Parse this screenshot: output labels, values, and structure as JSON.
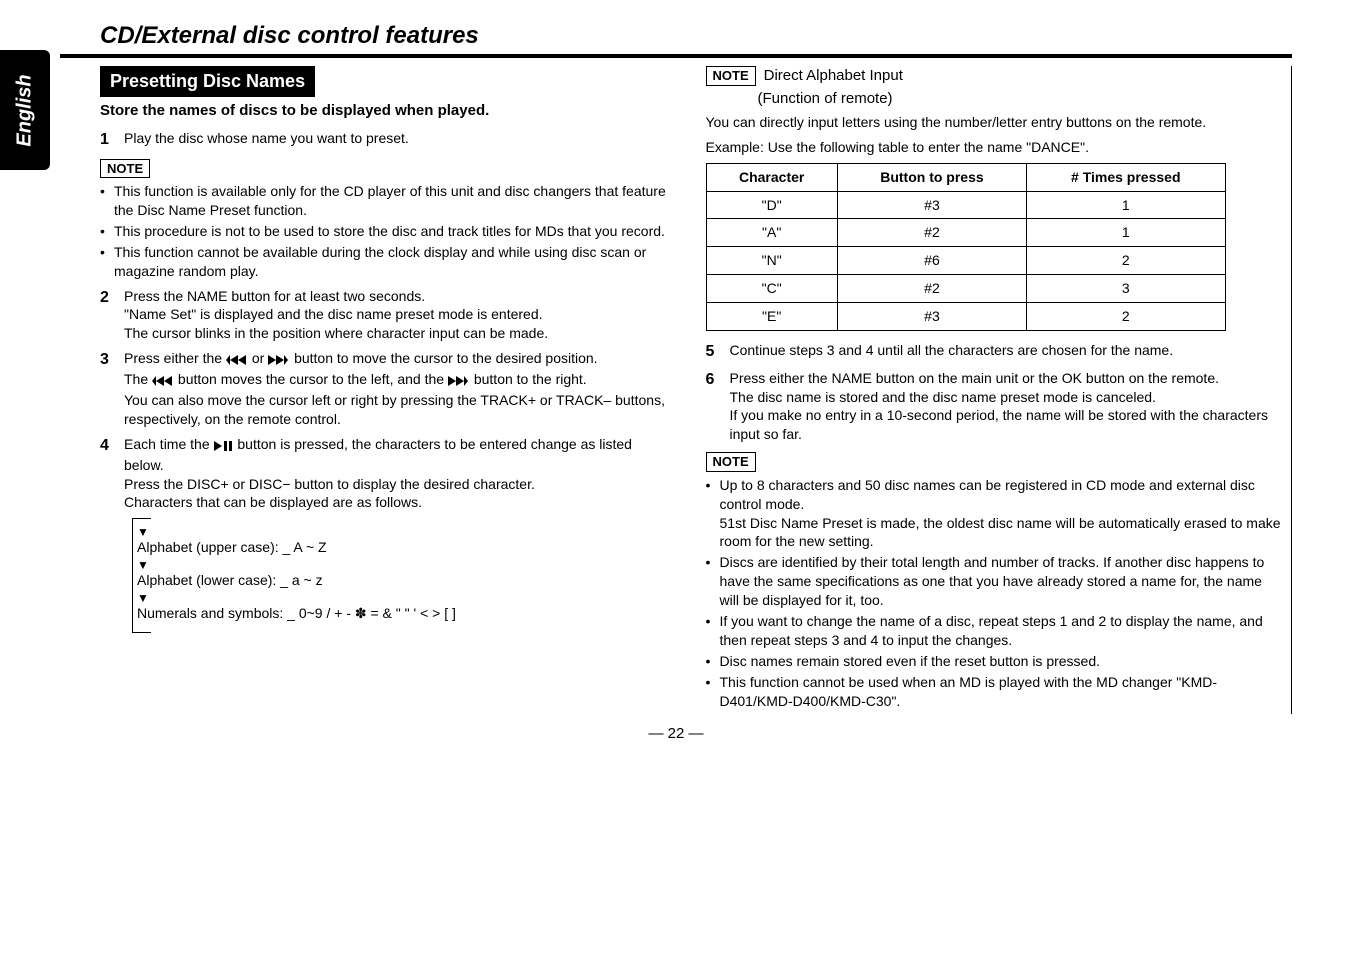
{
  "lang_tab": "English",
  "page_title": "CD/External disc control features",
  "section_head": "Presetting Disc Names",
  "section_sub": "Store the names of discs to be displayed when played.",
  "note_label": "NOTE",
  "left": {
    "step1": "Play the disc whose name you want to preset.",
    "note1": [
      "This function is available only for the CD player of this unit and disc changers that feature the Disc Name Preset function.",
      "This procedure is not to be used to store the disc and track titles for MDs that you record.",
      "This function cannot be available during the clock display and while using disc scan or magazine random play."
    ],
    "step2_a": "Press the NAME button for at least two seconds.",
    "step2_b": "\"Name Set\" is displayed and the disc name preset mode is entered.",
    "step2_c": "The cursor blinks in the position where character input can be made.",
    "step3_pre": "Press either the ",
    "step3_mid": " or ",
    "step3_post": " button to move the cursor to the desired position.",
    "step3_b_pre": "The ",
    "step3_b_mid": " button moves the cursor to the left, and the ",
    "step3_b_post": " button to the right.",
    "step3_c": "You can also move the cursor left or right by pressing the TRACK+ or TRACK– buttons, respectively, on the remote control.",
    "step4_a_pre": "Each time the ",
    "step4_a_post": " button is pressed, the characters to be entered change as listed below.",
    "step4_b": "Press the DISC+ or DISC− button to display the desired character.",
    "step4_c": "Characters that can be displayed are as follows.",
    "chars": {
      "upper": "Alphabet (upper case): _ A ~ Z",
      "lower": "Alphabet (lower case): _ a ~ z",
      "nums": "Numerals and symbols: _ 0~9 / + - ✽ = & \" \" ' < > [ ]"
    }
  },
  "right": {
    "note_title": "Direct Alphabet Input",
    "note_sub": "(Function of remote)",
    "p1": "You can directly input letters using the number/letter entry buttons on the remote.",
    "p2": "Example: Use the following table to enter the name \"DANCE\".",
    "table": {
      "head": [
        "Character",
        "Button to press",
        "# Times pressed"
      ],
      "rows": [
        [
          "\"D\"",
          "#3",
          "1"
        ],
        [
          "\"A\"",
          "#2",
          "1"
        ],
        [
          "\"N\"",
          "#6",
          "2"
        ],
        [
          "\"C\"",
          "#2",
          "3"
        ],
        [
          "\"E\"",
          "#3",
          "2"
        ]
      ]
    },
    "step5": "Continue steps 3 and 4 until all the characters are chosen for the name.",
    "step6_a": "Press either the NAME button on the main unit or the OK button on the remote.",
    "step6_b": "The disc name is stored and the disc name preset mode is canceled.",
    "step6_c": "If you make no entry in a 10-second period, the name will be stored with the characters input so far.",
    "note2": [
      "Up to 8 characters and 50 disc names can be registered in CD mode and external disc control mode.\n51st Disc Name Preset is made, the oldest disc name will be automatically erased to make room for the new setting.",
      "Discs are identified by their total length and number of tracks. If another disc happens to have the same specifications as one that you have already stored a name for, the name will be displayed for it, too.",
      "If you want to change the name of a disc, repeat steps 1 and 2 to display the name, and then repeat steps 3 and 4 to input the changes.",
      "Disc names remain stored even if the reset button is pressed.",
      "This function cannot be used when an MD is played with the MD changer \"KMD-D401/KMD-D400/KMD-C30\"."
    ]
  },
  "page_number": "— 22 —",
  "chart_data": {
    "type": "table",
    "title": "Example: Use the following table to enter the name \"DANCE\".",
    "columns": [
      "Character",
      "Button to press",
      "# Times pressed"
    ],
    "rows": [
      {
        "Character": "\"D\"",
        "Button to press": "#3",
        "# Times pressed": 1
      },
      {
        "Character": "\"A\"",
        "Button to press": "#2",
        "# Times pressed": 1
      },
      {
        "Character": "\"N\"",
        "Button to press": "#6",
        "# Times pressed": 2
      },
      {
        "Character": "\"C\"",
        "Button to press": "#2",
        "# Times pressed": 3
      },
      {
        "Character": "\"E\"",
        "Button to press": "#3",
        "# Times pressed": 2
      }
    ]
  }
}
